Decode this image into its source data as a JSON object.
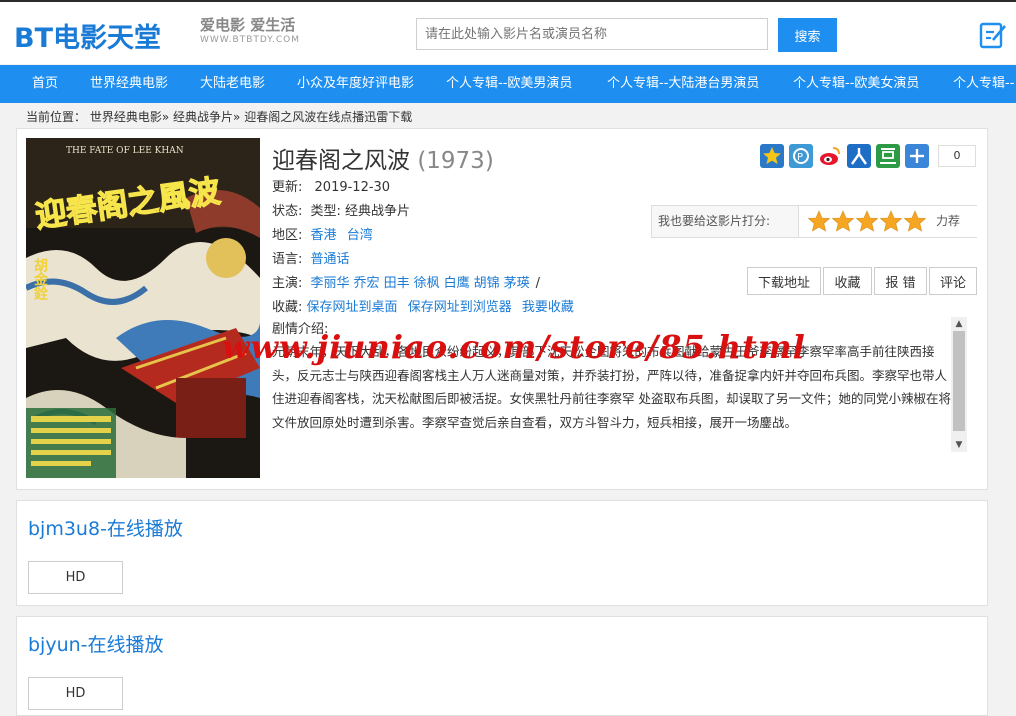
{
  "site": {
    "logo": "BT电影天堂",
    "slogan": "爱电影 爱生活",
    "domain": "WWW.BTBTDY.COM"
  },
  "search": {
    "placeholder": "请在此处输入影片名或演员名称",
    "button": "搜索"
  },
  "nav": {
    "items": [
      "首页",
      "世界经典电影",
      "大陆老电影",
      "小众及年度好评电影",
      "个人专辑--欧美男演员",
      "个人专辑--大陆港台男演员",
      "个人专辑--欧美女演员",
      "个人专辑--"
    ]
  },
  "breadcrumb": {
    "label": "当前位置：",
    "links": [
      "世界经典电影",
      "经典战争片"
    ],
    "current": "迎春阁之风波在线点播迅雷下载",
    "sep": "»"
  },
  "movie": {
    "title": "迎春阁之风波",
    "year": "(1973)",
    "poster": {
      "top_text": "THE FATE OF LEE KHAN",
      "big_title": "迎春阁之風波",
      "director": "胡金銓"
    },
    "updated_label": "更新:",
    "updated": "2019-12-30",
    "status_label": "状态:",
    "status": "类型: 经典战争片",
    "region_label": "地区:",
    "regions": [
      "香港",
      "台湾"
    ],
    "language_label": "语言:",
    "language": "普通话",
    "cast_label": "主演:",
    "cast": [
      "李丽华",
      "乔宏",
      "田丰",
      "徐枫",
      "白鹰",
      "胡锦",
      "茅瑛"
    ],
    "cast_tail": "/",
    "bookmark_label": "收藏:",
    "bookmarks": [
      "保存网址到桌面",
      "保存网址到浏览器",
      "我要收藏"
    ],
    "plot_label": "剧情介绍:",
    "plot": "元朝末年，天下大乱，各地民众纷纷起义，其部下沈天松企图将朱的布兵图献给蒙古王爷李察罕李察罕率高手前往陕西接头，反元志士与陕西迎春阁客栈主人万人迷商量对策，并乔装打扮，严阵以待，准备捉拿内奸并夺回布兵图。李察罕也带人住进迎春阁客栈，沈天松献图后即被活捉。女侠黑牡丹前往李察罕  处盗取布兵图，却误取了另一文件；她的同党小辣椒在将文件放回原处时遭到杀害。李察罕查觉后亲自查看，双方斗智斗力，短兵相接，展开一场鏖战。"
  },
  "share": {
    "icons": [
      "qzone-star-icon",
      "pengyou-icon",
      "weibo-icon",
      "renren-icon",
      "douban-icon",
      "more-share-icon"
    ],
    "count": "0"
  },
  "rating": {
    "label": "我也要给这影片打分:",
    "stars": 5,
    "recommend": "力荐"
  },
  "actions": [
    "下载地址",
    "收藏",
    "报 错",
    "评论"
  ],
  "watermark": "www.jiuniao.com/store/85.html",
  "playlists": [
    {
      "title": "bjm3u8-在线播放",
      "quality": "HD"
    },
    {
      "title": "bjyun-在线播放",
      "quality": "HD"
    }
  ],
  "colors": {
    "brand": "#1e8ff0",
    "link": "#1a7bd6",
    "watermark": "#d81010"
  }
}
